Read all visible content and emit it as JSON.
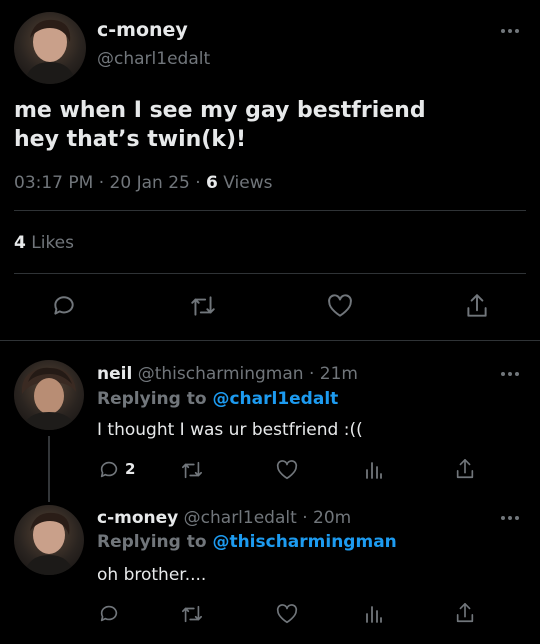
{
  "main_tweet": {
    "display_name": "c-money",
    "handle": "@charl1edalt",
    "text_line1": "me when I see my gay bestfriend",
    "text_line2": "hey that’s twin(k)!",
    "time": "03:17 PM",
    "date": "20 Jan 25",
    "views_count": "6",
    "views_label": "Views",
    "likes_count": "4",
    "likes_label": "Likes"
  },
  "replies": [
    {
      "display_name": "neil",
      "handle": "@thischarmingman",
      "age": "21m",
      "replying_prefix": "Replying to",
      "replying_to": "@charl1edalt",
      "text": "I thought I was ur bestfriend :((",
      "reply_count": "2"
    },
    {
      "display_name": "c-money",
      "handle": "@charl1edalt",
      "age": "20m",
      "replying_prefix": "Replying to",
      "replying_to": "@thischarmingman",
      "text": "oh brother...."
    }
  ],
  "separator": "·",
  "colors": {
    "background": "#000000",
    "text": "#e7e9ea",
    "muted": "#71767b",
    "link": "#1d9bf0",
    "divider": "#2f3336"
  },
  "icons": [
    "more-icon",
    "reply-icon",
    "retweet-icon",
    "like-icon",
    "share-icon",
    "analytics-icon"
  ]
}
